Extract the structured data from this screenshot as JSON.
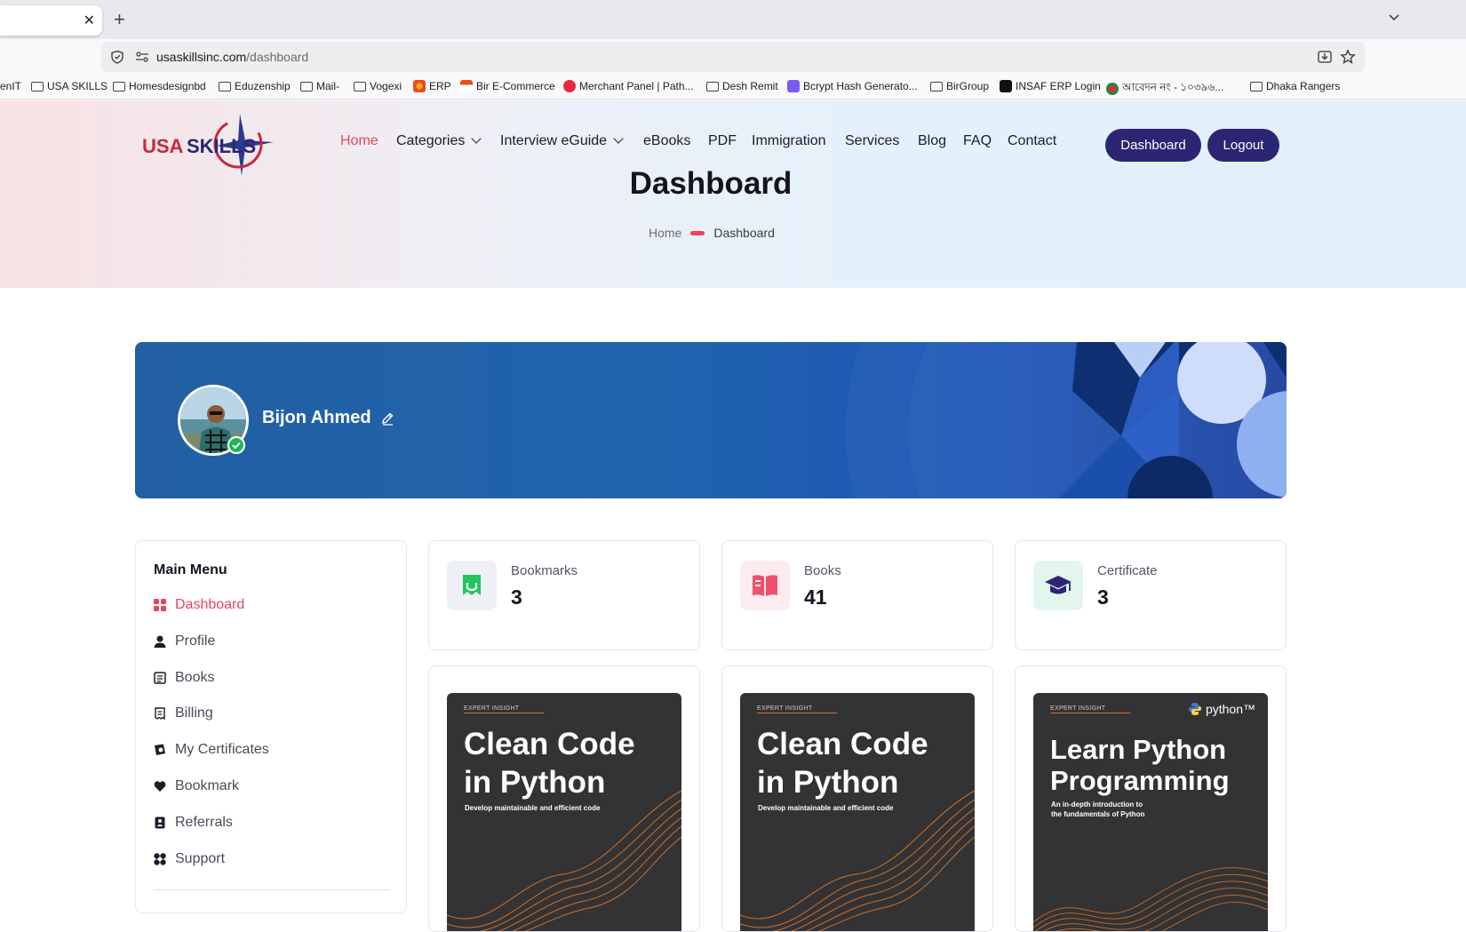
{
  "browser": {
    "tab_close_glyph": "✕",
    "new_tab_glyph": "+",
    "url_host": "usaskillsinc.com",
    "url_path": "/dashboard",
    "bookmarks": [
      {
        "label": "enIT",
        "icon": "none"
      },
      {
        "label": "USA SKILLS",
        "icon": "folder-icon"
      },
      {
        "label": "Homesdesignbd",
        "icon": "folder-icon"
      },
      {
        "label": "Eduzenship",
        "icon": "folder-icon"
      },
      {
        "label": "Mail-",
        "icon": "folder-icon"
      },
      {
        "label": "Vogexi",
        "icon": "folder-icon"
      },
      {
        "label": "ERP",
        "icon": "gear-favicon"
      },
      {
        "label": "Bir E-Commerce",
        "icon": "site-favicon"
      },
      {
        "label": "Merchant Panel | Path...",
        "icon": "site-favicon"
      },
      {
        "label": "Desh Remit",
        "icon": "folder-icon"
      },
      {
        "label": "Bcrypt Hash Generato...",
        "icon": "site-favicon"
      },
      {
        "label": "BirGroup",
        "icon": "folder-icon"
      },
      {
        "label": "INSAF ERP Login",
        "icon": "site-favicon"
      },
      {
        "label": "আবেদন নং - ১০৩৯৬...",
        "icon": "site-favicon"
      },
      {
        "label": "Dhaka Rangers",
        "icon": "folder-icon"
      }
    ]
  },
  "site": {
    "logo_text": "USA SKILLS",
    "nav": [
      {
        "label": "Home",
        "active": true,
        "dropdown": false
      },
      {
        "label": "Categories",
        "active": false,
        "dropdown": true
      },
      {
        "label": "Interview eGuide",
        "active": false,
        "dropdown": true
      },
      {
        "label": "eBooks",
        "active": false,
        "dropdown": false
      },
      {
        "label": "PDF",
        "active": false,
        "dropdown": false
      },
      {
        "label": "Immigration",
        "active": false,
        "dropdown": false
      },
      {
        "label": "Services",
        "active": false,
        "dropdown": false
      },
      {
        "label": "Blog",
        "active": false,
        "dropdown": false
      },
      {
        "label": "FAQ",
        "active": false,
        "dropdown": false
      },
      {
        "label": "Contact",
        "active": false,
        "dropdown": false
      }
    ],
    "dashboard_button": "Dashboard",
    "logout_button": "Logout",
    "page_title": "Dashboard",
    "breadcrumb": {
      "home": "Home",
      "current": "Dashboard"
    },
    "accent_color": "#e8455b",
    "brand_color": "#2b2573"
  },
  "profile": {
    "name": "Bijon Ahmed",
    "verified": true
  },
  "sidebar": {
    "heading": "Main Menu",
    "items": [
      {
        "label": "Dashboard",
        "icon": "dashboard-icon",
        "active": true
      },
      {
        "label": "Profile",
        "icon": "user-icon",
        "active": false
      },
      {
        "label": "Books",
        "icon": "book-icon",
        "active": false
      },
      {
        "label": "Billing",
        "icon": "receipt-icon",
        "active": false
      },
      {
        "label": "My Certificates",
        "icon": "certificate-icon",
        "active": false
      },
      {
        "label": "Bookmark",
        "icon": "heart-icon",
        "active": false
      },
      {
        "label": "Referrals",
        "icon": "referral-icon",
        "active": false
      },
      {
        "label": "Support",
        "icon": "support-icon",
        "active": false
      }
    ]
  },
  "stats": [
    {
      "label": "Bookmarks",
      "value": "3",
      "icon": "bookmark-icon",
      "color": "#22c55e"
    },
    {
      "label": "Books",
      "value": "41",
      "icon": "open-book-icon",
      "color": "#f0506e"
    },
    {
      "label": "Certificate",
      "value": "3",
      "icon": "graduation-cap-icon",
      "color": "#2b2573"
    }
  ],
  "books": [
    {
      "tag": "EXPERT INSIGHT",
      "title_line1": "Clean Code",
      "title_line2": "in Python",
      "subtitle_line1": "Develop maintainable and efficient code",
      "subtitle_line2": "",
      "badge": ""
    },
    {
      "tag": "EXPERT INSIGHT",
      "title_line1": "Clean Code",
      "title_line2": "in Python",
      "subtitle_line1": "Develop maintainable and efficient code",
      "subtitle_line2": "",
      "badge": ""
    },
    {
      "tag": "EXPERT INSIGHT",
      "title_line1": "Learn Python",
      "title_line2": "Programming",
      "subtitle_line1": "An in-depth introduction to",
      "subtitle_line2": "the fundamentals of Python",
      "badge": "python™"
    }
  ]
}
